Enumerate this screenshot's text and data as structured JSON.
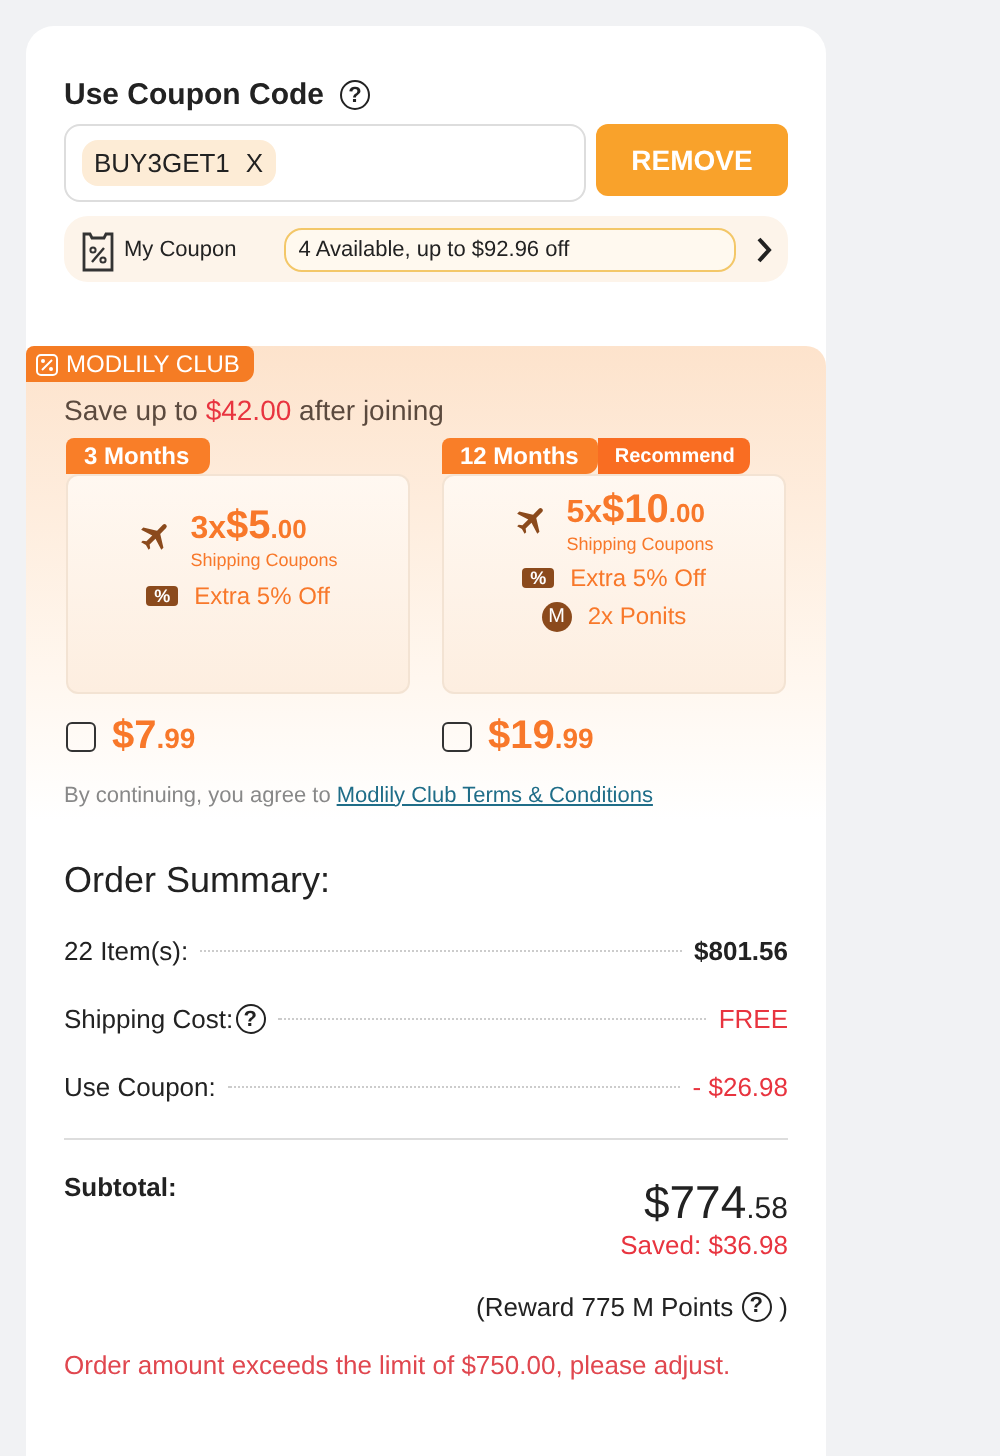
{
  "coupon": {
    "title": "Use Coupon Code",
    "help": "?",
    "code": "BUY3GET1",
    "remove_code": "X",
    "button": "REMOVE",
    "my_coupon": {
      "label": "My Coupon",
      "summary": "4 Available, up to $92.96 off"
    }
  },
  "club": {
    "badge": "MODLILY CLUB",
    "save_prefix": "Save up to",
    "save_amount": "$42.00",
    "save_suffix": "after joining",
    "plans": [
      {
        "term": "3 Months",
        "coupon_count": "3x",
        "coupon_value": "$5",
        "coupon_cents": ".00",
        "coupon_label": "Shipping Coupons",
        "perks": [
          {
            "kind": "ticket",
            "icon": "%",
            "text": "Extra 5% Off"
          }
        ],
        "price": "$7",
        "price_cents": ".99",
        "checked": false
      },
      {
        "term": "12 Months",
        "tag": "Recommend",
        "coupon_count": "5x",
        "coupon_value": "$10",
        "coupon_cents": ".00",
        "coupon_label": "Shipping Coupons",
        "perks": [
          {
            "kind": "ticket",
            "icon": "%",
            "text": "Extra 5% Off"
          },
          {
            "kind": "coin",
            "icon": "M",
            "text": "2x Ponits"
          }
        ],
        "price": "$19",
        "price_cents": ".99",
        "checked": false
      }
    ],
    "terms_prefix": "By continuing, you agree to",
    "terms_link": "Modlily Club Terms & Conditions"
  },
  "summary": {
    "title": "Order Summary:",
    "rows": [
      {
        "label": "22 Item(s):",
        "value": "$801.56",
        "kind": "amount"
      },
      {
        "label": "Shipping Cost:",
        "help": "?",
        "value": "FREE",
        "kind": "discount"
      },
      {
        "label": "Use Coupon:",
        "value": "- $26.98",
        "kind": "discount"
      }
    ],
    "subtotal_label": "Subtotal:",
    "subtotal": "$774",
    "subtotal_cents": ".58",
    "saved": "Saved: $36.98",
    "reward": "(Reward 775 M Points",
    "reward_help": "?",
    "reward_close": ")",
    "warning": "Order amount exceeds the limit of $750.00, please adjust."
  }
}
